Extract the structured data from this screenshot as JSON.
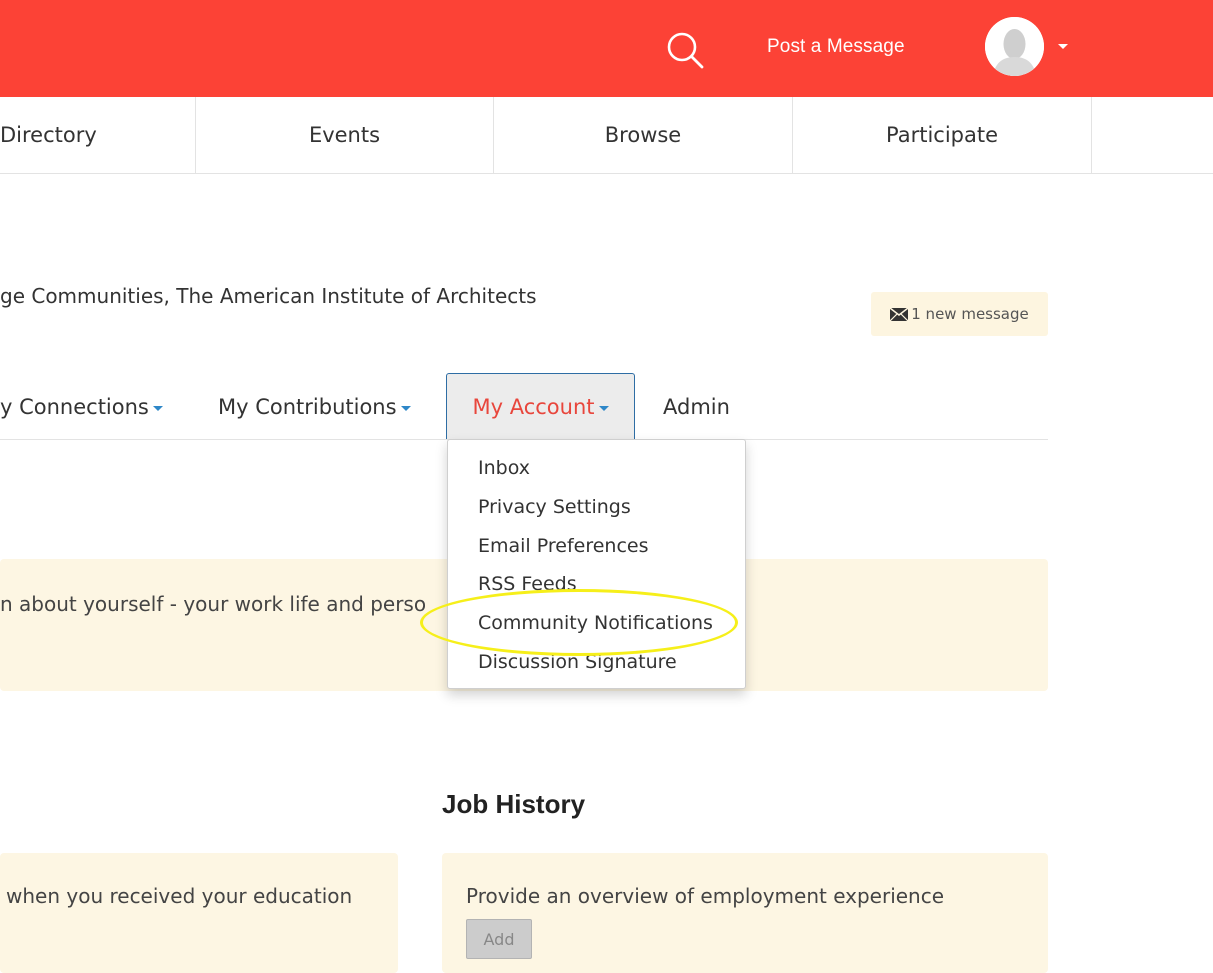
{
  "header": {
    "post_label": "Post a Message",
    "icons": {
      "search": "search-icon",
      "avatar": "avatar-icon",
      "caret": "chevron-down-icon"
    },
    "bg_color": "#fc4236"
  },
  "nav": {
    "items": [
      {
        "label": "Directory"
      },
      {
        "label": "Events"
      },
      {
        "label": "Browse"
      },
      {
        "label": "Participate"
      }
    ]
  },
  "profile": {
    "org_text": "ge Communities, The American Institute of Architects",
    "message_badge": "1 new message",
    "message_icon": "envelope-icon"
  },
  "tabs": {
    "connections": "y Connections",
    "contributions": "My Contributions",
    "account": "My Account",
    "admin": "Admin"
  },
  "account_menu": {
    "items": [
      {
        "label": "Inbox"
      },
      {
        "label": "Privacy Settings"
      },
      {
        "label": "Email Preferences"
      },
      {
        "label": "RSS Feeds"
      },
      {
        "label": "Community Notifications"
      },
      {
        "label": "Discussion Signature"
      }
    ],
    "highlight_color": "#f6ef1a"
  },
  "about_panel": {
    "text": "n about yourself - your work life and perso"
  },
  "education_panel": {
    "text": "when you received your education"
  },
  "job_history": {
    "title": "Job History",
    "text": "Provide an overview of employment experience",
    "add_label": "Add"
  }
}
